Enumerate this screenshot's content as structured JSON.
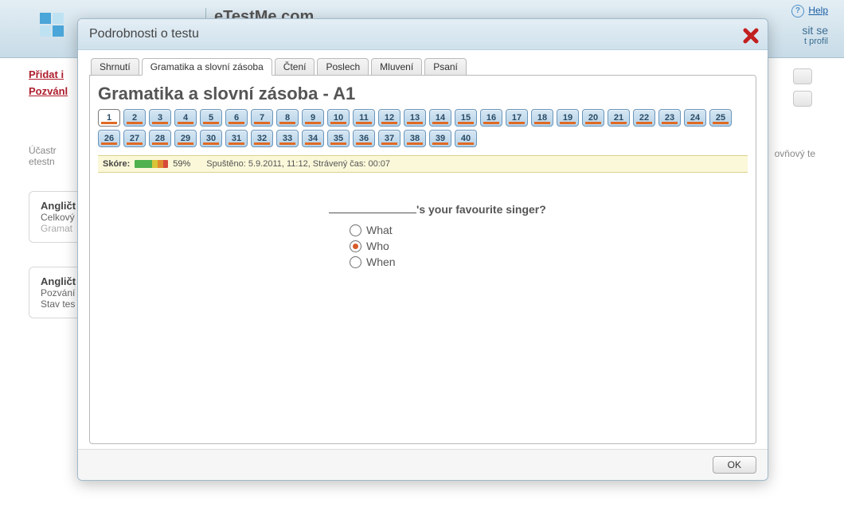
{
  "bg": {
    "sitename": "eTestMe.com",
    "help_label": "Help",
    "signup_right1": "sit se",
    "signup_right2": "t profil",
    "link1": "Přidat i",
    "link2": "Pozvánl",
    "participant_label": "Účastr",
    "row1": "etestn",
    "box1_title": "Angličt",
    "box1_line1": "Celkový",
    "box1_line2": "Gramat",
    "box2_title": "Angličt",
    "box2_line1": "Pozvání",
    "box2_line2": "Stav tes",
    "right_col": "ovňový te"
  },
  "modal": {
    "title": "Podrobnosti o testu",
    "ok_label": "OK"
  },
  "tabs": [
    {
      "label": "Shrnutí"
    },
    {
      "label": "Gramatika a slovní zásoba"
    },
    {
      "label": "Čtení"
    },
    {
      "label": "Poslech"
    },
    {
      "label": "Mluvení"
    },
    {
      "label": "Psaní"
    }
  ],
  "panel": {
    "heading": "Gramatika a slovní zásoba - A1",
    "question_count": 40,
    "current_question": 1
  },
  "score": {
    "label": "Skóre:",
    "percent": "59%",
    "meta": "Spuštěno: 5.9.2011, 11:12, Strávený čas: 00:07",
    "segments": [
      {
        "class": "seg-g",
        "width": 22
      },
      {
        "class": "seg-y",
        "width": 7
      },
      {
        "class": "seg-o",
        "width": 7
      },
      {
        "class": "seg-r",
        "width": 6
      }
    ]
  },
  "question": {
    "text_after_blank": "'s your favourite singer?",
    "options": [
      {
        "label": "What",
        "selected": false
      },
      {
        "label": "Who",
        "selected": true
      },
      {
        "label": "When",
        "selected": false
      }
    ]
  }
}
